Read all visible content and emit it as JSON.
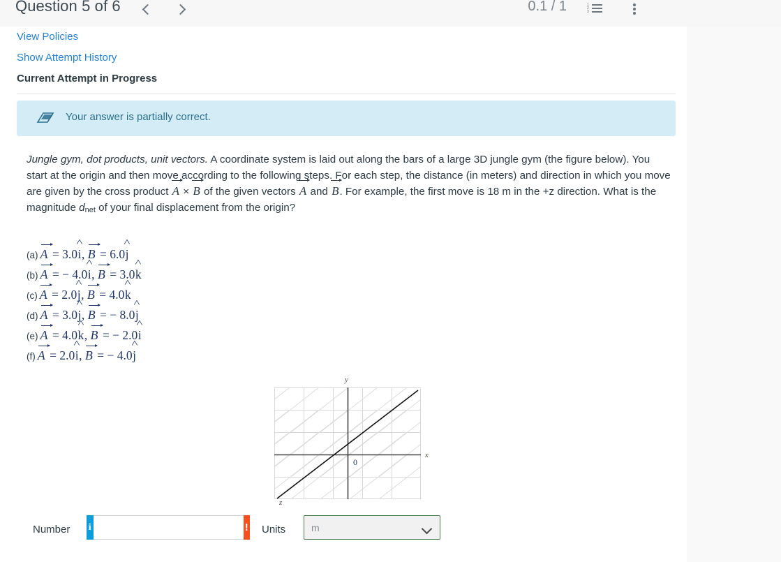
{
  "header": {
    "question_title": "Question 5 of 6",
    "prev_label": "‹",
    "next_label": "›",
    "score": "0.1 / 1",
    "list_icon": "numbered-list-icon",
    "menu_icon": "kebab-menu-icon",
    "list_numbers": [
      "1",
      "2",
      "3"
    ]
  },
  "links": {
    "view_policies": "View Policies",
    "show_attempt_history": "Show Attempt History",
    "current_attempt": "Current Attempt in Progress"
  },
  "alert": {
    "icon": "eraser-icon",
    "text": "Your answer is partially correct.",
    "background_color": "#d4ecf6",
    "text_color": "#2b6f8e"
  },
  "question": {
    "title_italic": "Jungle gym, dot products, unit vectors.",
    "part1": " A coordinate system is laid out along the bars of a large 3D jungle gym (the figure below). You start at the origin and then move according to the following steps. For each step, the distance (in meters) and direction in which you move are given by the cross product ",
    "vec_a_1": "A",
    "times": " × ",
    "vec_b_1": "B",
    "part2": " of the given vectors ",
    "vec_a_2": "A",
    "and": " and ",
    "vec_b_2": "B",
    "part3": ". For example, the first move is 18 m in the +z direction. What is the magnitude ",
    "dnet_symbol": "d",
    "dnet_sub": "net",
    "part4": " of your final displacement from the origin?"
  },
  "vectors": [
    {
      "label": "(a)",
      "a_eq": " = 3.0",
      "a_unit": "i",
      "sep": ",  ",
      "b_eq": " = 6.0",
      "b_unit": "j"
    },
    {
      "label": "(b)",
      "a_eq": " =  − 4.0",
      "a_unit": "i",
      "sep": ",  ",
      "b_eq": " = 3.0",
      "b_unit": "k"
    },
    {
      "label": "(c)",
      "a_eq": " = 2.0",
      "a_unit": "j",
      "sep": ",  ",
      "b_eq": " = 4.0",
      "b_unit": "k"
    },
    {
      "label": "(d)",
      "a_eq": " = 3.0",
      "a_unit": "j",
      "sep": ",  ",
      "b_eq": " =  − 8.0",
      "b_unit": "j"
    },
    {
      "label": "(e)",
      "a_eq": " = 4.0",
      "a_unit": "k",
      "sep": ",  ",
      "b_eq": " =  − 2.0",
      "b_unit": "i"
    },
    {
      "label": "(f)",
      "a_eq": " = 2.0",
      "a_unit": "i",
      "sep": ",  ",
      "b_eq": " =  − 4.0",
      "b_unit": "j"
    }
  ],
  "vector_symbols": {
    "A": "A",
    "B": "B"
  },
  "figure": {
    "name": "jungle-gym-coordinate-diagram",
    "axis_x": "x",
    "axis_y": "y",
    "axis_z": "z",
    "origin": "0",
    "grid_color": "#d8d8d8",
    "axis_color": "#444444",
    "diagonal_color": "#d8d8d8",
    "z_axis_color": "#111111",
    "columns": 5,
    "rows": 5
  },
  "answer": {
    "number_label": "Number",
    "number_value": "",
    "number_placeholder": "",
    "info_badge": "i",
    "warn_badge": "!",
    "units_label": "Units",
    "units_value": "m",
    "units_options": [
      "m"
    ],
    "info_color": "#0d9ddb",
    "warn_color": "#f4511e",
    "units_border_color": "#4a7c4a"
  }
}
